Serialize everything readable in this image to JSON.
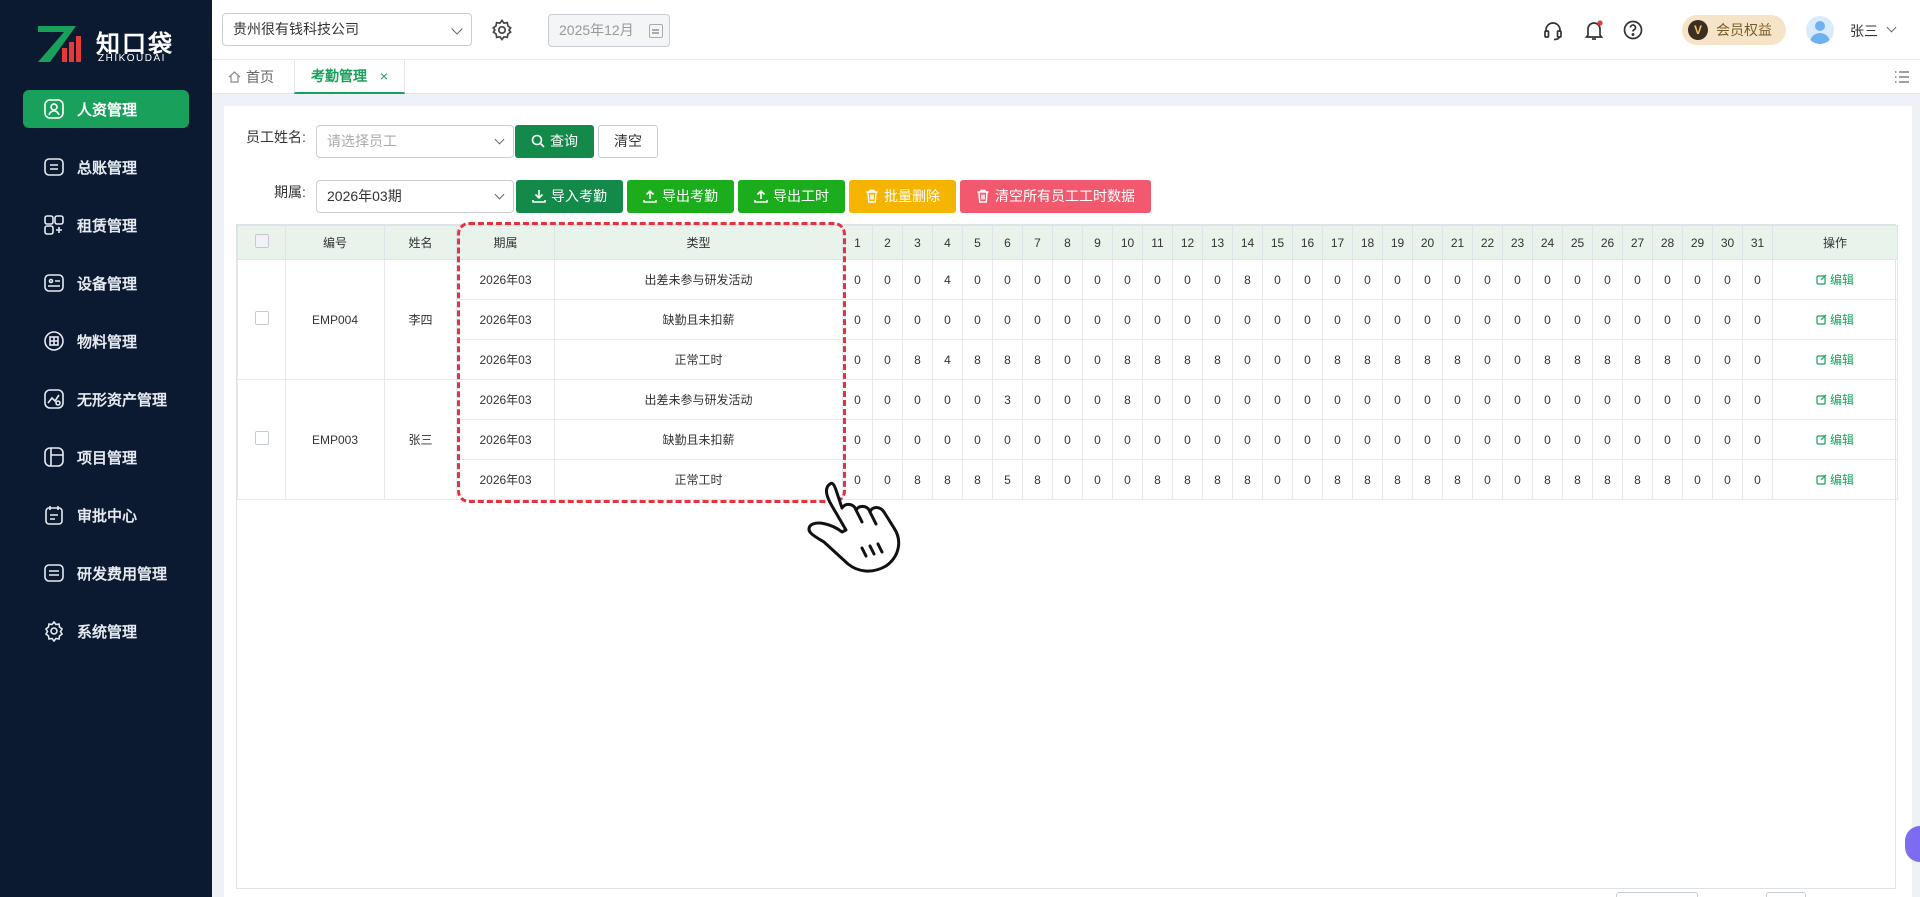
{
  "app": {
    "brand_cn": "知口袋",
    "brand_en": "ZHIKOUDAI",
    "accent": "#19a05a",
    "sidebar_bg": "#0b1a30"
  },
  "sidebar": {
    "items": [
      {
        "label": "人资管理",
        "icon": "user-icon",
        "active": true
      },
      {
        "label": "总账管理",
        "icon": "ledger-icon"
      },
      {
        "label": "租赁管理",
        "icon": "lease-icon"
      },
      {
        "label": "设备管理",
        "icon": "device-icon"
      },
      {
        "label": "物料管理",
        "icon": "material-icon"
      },
      {
        "label": "无形资产管理",
        "icon": "intangible-icon"
      },
      {
        "label": "项目管理",
        "icon": "project-icon"
      },
      {
        "label": "审批中心",
        "icon": "approval-icon"
      },
      {
        "label": "研发费用管理",
        "icon": "rnd-icon"
      },
      {
        "label": "系统管理",
        "icon": "gear-icon"
      }
    ]
  },
  "header": {
    "company": "贵州很有钱科技公司",
    "date": "2025年12月",
    "member_badge": "V",
    "member_label": "会员权益",
    "user_name": "张三"
  },
  "tabs": {
    "home": "首页",
    "active": "考勤管理",
    "close": "×"
  },
  "filters": {
    "employee_label": "员工姓名:",
    "employee_placeholder": "请选择员工",
    "query_button": "查询",
    "clear_button": "清空",
    "period_label": "期属:",
    "period_value": "2026年03期"
  },
  "actions": {
    "import": "导入考勤",
    "export": "导出考勤",
    "export_hours": "导出工时",
    "batch_delete": "批量删除",
    "clear_all": "清空所有员工工时数据"
  },
  "table": {
    "headers": {
      "code": "编号",
      "name": "姓名",
      "period": "期属",
      "type": "类型",
      "days": [
        "1",
        "2",
        "3",
        "4",
        "5",
        "6",
        "7",
        "8",
        "9",
        "10",
        "11",
        "12",
        "13",
        "14",
        "15",
        "16",
        "17",
        "18",
        "19",
        "20",
        "21",
        "22",
        "23",
        "24",
        "25",
        "26",
        "27",
        "28",
        "29",
        "30",
        "31"
      ],
      "ops": "操作"
    },
    "edit_label": "编辑",
    "employees": [
      {
        "code": "EMP004",
        "name": "李四",
        "rows": [
          {
            "period": "2026年03",
            "type": "出差未参与研发活动",
            "days": [
              "0",
              "0",
              "0",
              "4",
              "0",
              "0",
              "0",
              "0",
              "0",
              "0",
              "0",
              "0",
              "0",
              "8",
              "0",
              "0",
              "0",
              "0",
              "0",
              "0",
              "0",
              "0",
              "0",
              "0",
              "0",
              "0",
              "0",
              "0",
              "0",
              "0",
              "0"
            ]
          },
          {
            "period": "2026年03",
            "type": "缺勤且未扣薪",
            "days": [
              "0",
              "0",
              "0",
              "0",
              "0",
              "0",
              "0",
              "0",
              "0",
              "0",
              "0",
              "0",
              "0",
              "0",
              "0",
              "0",
              "0",
              "0",
              "0",
              "0",
              "0",
              "0",
              "0",
              "0",
              "0",
              "0",
              "0",
              "0",
              "0",
              "0",
              "0"
            ]
          },
          {
            "period": "2026年03",
            "type": "正常工时",
            "days": [
              "0",
              "0",
              "8",
              "4",
              "8",
              "8",
              "8",
              "0",
              "0",
              "8",
              "8",
              "8",
              "8",
              "0",
              "0",
              "0",
              "8",
              "8",
              "8",
              "8",
              "8",
              "0",
              "0",
              "8",
              "8",
              "8",
              "8",
              "8",
              "0",
              "0",
              "0"
            ]
          }
        ]
      },
      {
        "code": "EMP003",
        "name": "张三",
        "rows": [
          {
            "period": "2026年03",
            "type": "出差未参与研发活动",
            "days": [
              "0",
              "0",
              "0",
              "0",
              "0",
              "3",
              "0",
              "0",
              "0",
              "8",
              "0",
              "0",
              "0",
              "0",
              "0",
              "0",
              "0",
              "0",
              "0",
              "0",
              "0",
              "0",
              "0",
              "0",
              "0",
              "0",
              "0",
              "0",
              "0",
              "0",
              "0"
            ]
          },
          {
            "period": "2026年03",
            "type": "缺勤且未扣薪",
            "days": [
              "0",
              "0",
              "0",
              "0",
              "0",
              "0",
              "0",
              "0",
              "0",
              "0",
              "0",
              "0",
              "0",
              "0",
              "0",
              "0",
              "0",
              "0",
              "0",
              "0",
              "0",
              "0",
              "0",
              "0",
              "0",
              "0",
              "0",
              "0",
              "0",
              "0",
              "0"
            ]
          },
          {
            "period": "2026年03",
            "type": "正常工时",
            "days": [
              "0",
              "0",
              "8",
              "8",
              "8",
              "5",
              "8",
              "0",
              "0",
              "0",
              "8",
              "8",
              "8",
              "8",
              "0",
              "0",
              "8",
              "8",
              "8",
              "8",
              "8",
              "0",
              "0",
              "8",
              "8",
              "8",
              "8",
              "8",
              "0",
              "0",
              "0"
            ]
          }
        ]
      }
    ]
  }
}
